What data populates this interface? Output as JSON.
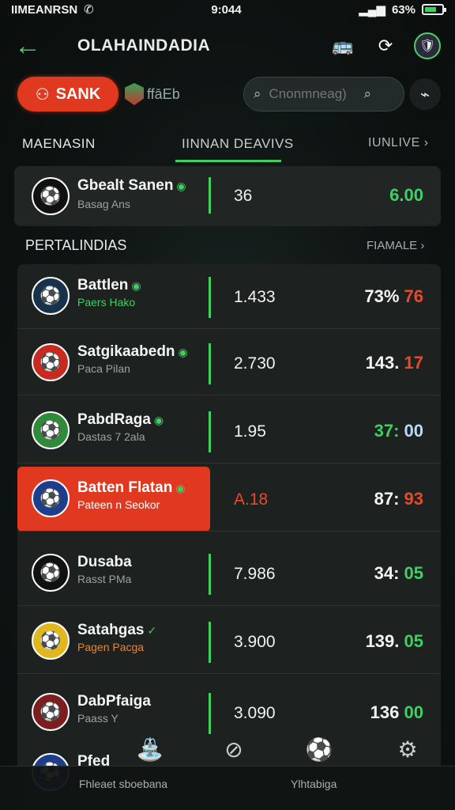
{
  "status": {
    "left": "IIMEANRSN",
    "time": "9:044",
    "battery": "63%"
  },
  "header": {
    "title": "OLAHAINDADIA"
  },
  "toolbar": {
    "bank_label": "SANK",
    "brand_text": "ffāEb",
    "search_placeholder": "Cnonmneag)"
  },
  "tabs": {
    "left": "MAENASIN",
    "center": "IINNAN DEAVIVS",
    "right": "IUNLIVE"
  },
  "featured": {
    "team": "Gbealt Sanen",
    "sub": "Basag Ans",
    "odd": "36",
    "value": "6.00",
    "value_color": "#3fcf63"
  },
  "section": {
    "label": "PERTALINDIAS",
    "more": "FIAMALE"
  },
  "rows": [
    {
      "team": "Battlen",
      "sub": "Paers Hako",
      "odd": "1.433",
      "val_a": "73%",
      "val_b": "76",
      "b_color": "#e54b2a"
    },
    {
      "team": "Satgikaabedn",
      "sub": "Paca Pilan",
      "odd": "2.730",
      "val_a": "143.",
      "val_b": "17",
      "b_color": "#e54b2a"
    },
    {
      "team": "PabdRaga",
      "sub": "Dastas 7 2ala",
      "odd": "1.95",
      "val_a": "37:",
      "val_b": "00",
      "a_color": "#3fcf63",
      "b_color": "#b7dcf7"
    },
    {
      "team": "Batten Flatan",
      "sub": "Pateen n Seokor",
      "odd": "A.18",
      "val_a": "87:",
      "val_b": "93",
      "b_color": "#e54b2a"
    },
    {
      "team": "Dusaba",
      "sub": "Rasst PMa",
      "odd": "7.986",
      "val_a": "34:",
      "val_b": "05",
      "b_color": "#3fcf63"
    },
    {
      "team": "Satahgas",
      "sub": "Pagen Pacga",
      "odd": "3.900",
      "val_a": "139.",
      "val_b": "05",
      "b_color": "#3fcf63"
    },
    {
      "team": "DabPfaiga",
      "sub": "Paass Y",
      "odd": "3.090",
      "val_a": "136",
      "val_b": "00",
      "b_color": "#3fcf63"
    },
    {
      "team": "Pfed",
      "sub": "",
      "odd": "",
      "val_a": "",
      "val_b": "",
      "b_color": "#3fcf63"
    }
  ],
  "bottom": {
    "left_label": "Fhleaet sboebana",
    "right_label": "Ylhtabiga"
  },
  "icons": [
    "back-arrow-icon",
    "bus-icon",
    "refresh-icon",
    "avatar",
    "search-icon",
    "filter-icon"
  ]
}
